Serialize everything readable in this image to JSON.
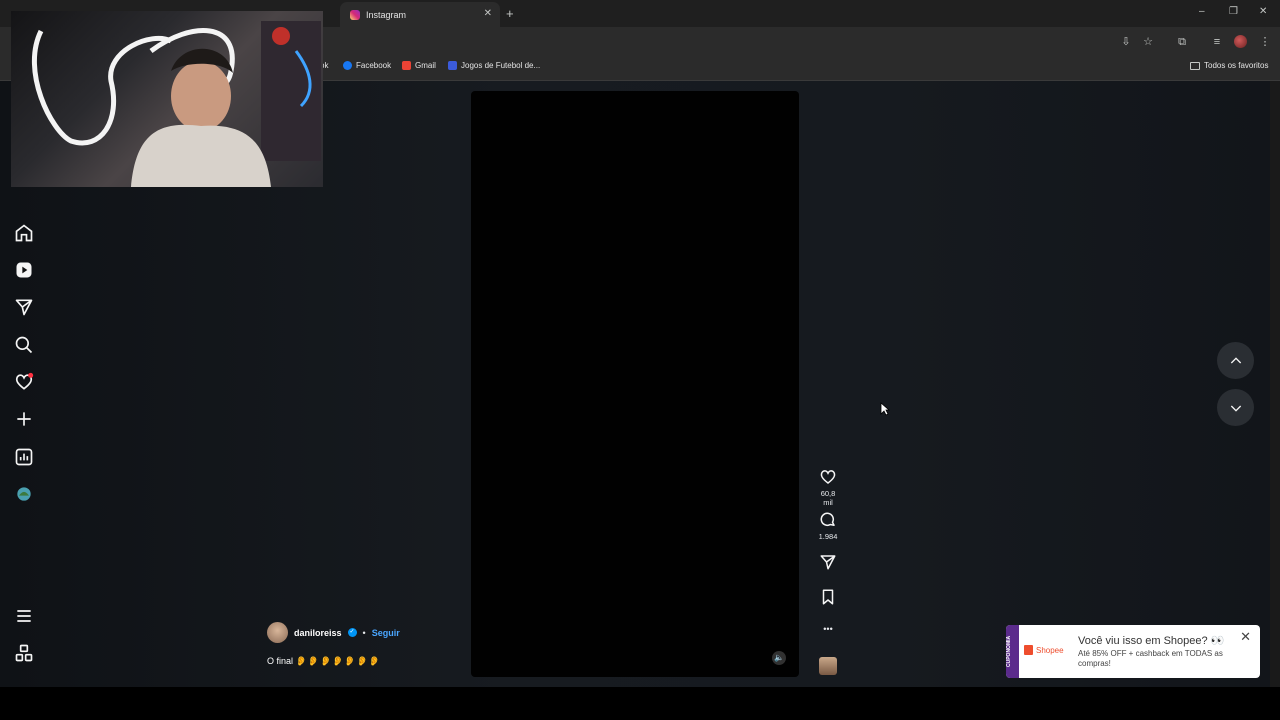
{
  "browser": {
    "active_tab_title": "Instagram",
    "new_tab_symbol": "+",
    "window_controls": [
      "–",
      "❐",
      "✕"
    ],
    "bookmarks": [
      {
        "label": "ok",
        "icon": "bookmark-icon"
      },
      {
        "label": "Facebook",
        "icon": "facebook-icon",
        "color": "#1877f2"
      },
      {
        "label": "Gmail",
        "icon": "gmail-icon",
        "color": "#ea4335"
      },
      {
        "label": "Jogos de Futebol de...",
        "icon": "game-icon",
        "color": "#3b5bdb"
      }
    ],
    "all_bookmarks_label": "Todos os favoritos"
  },
  "sidebar": {
    "items": [
      {
        "name": "home-icon"
      },
      {
        "name": "reels-icon"
      },
      {
        "name": "messages-icon"
      },
      {
        "name": "search-icon"
      },
      {
        "name": "notifications-icon"
      },
      {
        "name": "create-icon"
      },
      {
        "name": "dashboard-icon"
      },
      {
        "name": "profile-avatar"
      }
    ],
    "bottom": [
      {
        "name": "menu-icon"
      },
      {
        "name": "threads-icon"
      }
    ]
  },
  "reel": {
    "author": "daniloreiss",
    "separator": "•",
    "follow_label": "Seguir",
    "caption_text": "O final",
    "caption_emojis": "👂👂👂👂👂👂👂",
    "mute_symbol": "🔈",
    "likes": "60,8 mil",
    "comments": "1.984",
    "more_symbol": "•••"
  },
  "ad": {
    "brand": "Shopee",
    "strip_label": "CUPONOMIA",
    "title": "Você viu isso em Shopee? 👀",
    "description": "Até 85% OFF + cashback em TODAS as compras!",
    "close_symbol": "✕"
  },
  "colors": {
    "accent_blue": "#4aa6ff",
    "notification_dot": "#ff3040",
    "shopee_orange": "#ee4d2d"
  }
}
